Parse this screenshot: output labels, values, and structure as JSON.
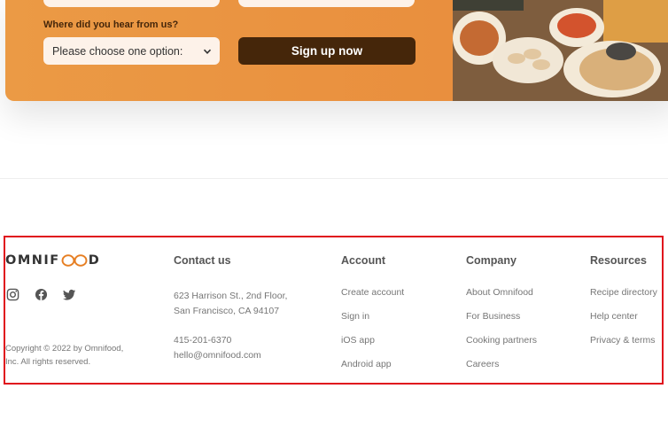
{
  "cta": {
    "source_label": "Where did you hear from us?",
    "select_value": "Please choose one option:",
    "submit_label": "Sign up now"
  },
  "footer": {
    "logo_left": "OMNIF",
    "logo_right": "D",
    "socials": [
      "instagram-icon",
      "facebook-icon",
      "twitter-icon"
    ],
    "copyright_line1": "Copyright © 2022 by Omnifood,",
    "copyright_line2": "Inc. All rights reserved.",
    "contact": {
      "title": "Contact us",
      "address_line1": "623 Harrison St., 2nd Floor,",
      "address_line2": "San Francisco, CA 94107",
      "phone": "415-201-6370",
      "email": "hello@omnifood.com"
    },
    "account": {
      "title": "Account",
      "links": [
        "Create account",
        "Sign in",
        "iOS app",
        "Android app"
      ]
    },
    "company": {
      "title": "Company",
      "links": [
        "About Omnifood",
        "For Business",
        "Cooking partners",
        "Careers"
      ]
    },
    "resources": {
      "title": "Resources",
      "links": [
        "Recipe directory",
        "Help center",
        "Privacy & terms"
      ]
    }
  },
  "colors": {
    "cta_orange": "#e8893a",
    "button_brown": "#45260a",
    "highlight_red": "#e0101d",
    "logo_accent": "#e67e22"
  }
}
